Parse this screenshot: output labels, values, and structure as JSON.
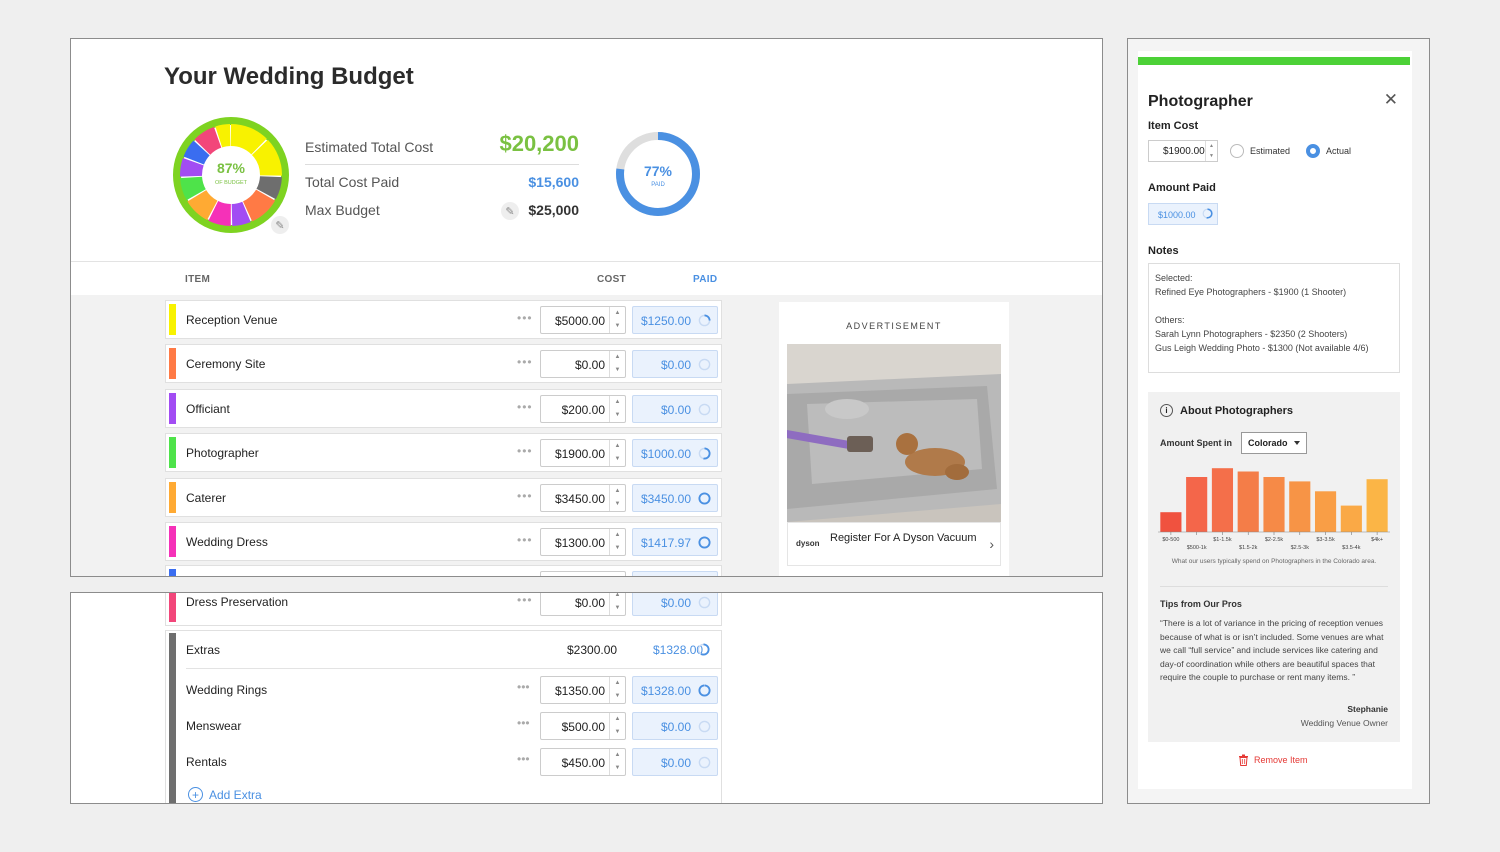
{
  "budget": {
    "title": "Your Wedding Budget",
    "donut_pct": "87%",
    "donut_sub": "OF BUDGET",
    "donut_fraction": 0.87,
    "est_label": "Estimated Total Cost",
    "est_value": "$20,200",
    "paid_label": "Total Cost Paid",
    "paid_value": "$15,600",
    "max_label": "Max Budget",
    "max_value": "$25,000",
    "ring_pct": "77%",
    "ring_sub": "PAID",
    "ring_fraction": 0.77
  },
  "table": {
    "col_item": "ITEM",
    "col_cost": "COST",
    "col_paid": "PAID",
    "rows": [
      {
        "name": "Reception Venue",
        "cost": "$5000.00",
        "paid": "$1250.00",
        "color": "#f8f200",
        "progress": 0.25
      },
      {
        "name": "Ceremony Site",
        "cost": "$0.00",
        "paid": "$0.00",
        "color": "#ff7a45",
        "progress": 0
      },
      {
        "name": "Officiant",
        "cost": "$200.00",
        "paid": "$0.00",
        "color": "#a24cf3",
        "progress": 0
      },
      {
        "name": "Photographer",
        "cost": "$1900.00",
        "paid": "$1000.00",
        "color": "#4ee34a",
        "progress": 0.53
      },
      {
        "name": "Caterer",
        "cost": "$3450.00",
        "paid": "$3450.00",
        "color": "#ffaa33",
        "progress": 1
      },
      {
        "name": "Wedding Dress",
        "cost": "$1300.00",
        "paid": "$1417.97",
        "color": "#f531b8",
        "progress": 1
      }
    ],
    "partial_row_color": "#3a6df0",
    "dress_preservation": {
      "name": "Dress Preservation",
      "cost": "$0.00",
      "paid": "$0.00",
      "color": "#f2467a"
    },
    "extras": {
      "name": "Extras",
      "cost": "$2300.00",
      "paid": "$1328.00",
      "progress": 0.58,
      "items": [
        {
          "name": "Wedding Rings",
          "cost": "$1350.00",
          "paid": "$1328.00",
          "progress": 0.98
        },
        {
          "name": "Menswear",
          "cost": "$500.00",
          "paid": "$0.00",
          "progress": 0
        },
        {
          "name": "Rentals",
          "cost": "$450.00",
          "paid": "$0.00",
          "progress": 0
        }
      ],
      "add_label": "Add Extra"
    }
  },
  "ad": {
    "label": "ADVERTISEMENT",
    "brand": "dyson",
    "text": "Register For A Dyson Vacuum"
  },
  "panel": {
    "title": "Photographer",
    "item_cost_label": "Item Cost",
    "item_cost": "$1900.00",
    "radio_estimated": "Estimated",
    "radio_actual": "Actual",
    "amount_paid_label": "Amount Paid",
    "amount_paid": "$1000.00",
    "notes_label": "Notes",
    "notes_lines": [
      "Selected:",
      "Refined Eye Photographers - $1900 (1 Shooter)",
      "",
      "Others:",
      "Sarah Lynn Photographers - $2350 (2 Shooters)",
      "Gus Leigh Wedding Photo - $1300 (Not available 4/6)"
    ],
    "about_title": "About Photographers",
    "amount_spent_label": "Amount Spent in",
    "region": "Colorado",
    "chart_caption": "What our users typically spend on Photographers in the Colorado area.",
    "tips_title": "Tips from Our Pros",
    "tips_quote": "“There is a lot of variance in the pricing of reception venues because of what is or isn’t included. Some venues are what we call “full service” and include services like catering and day-of coordination while others are beautiful spaces that require the couple to purchase or rent many items. ”",
    "tips_author": "Stephanie",
    "tips_role": "Wedding Venue Owner",
    "remove_label": "Remove Item"
  },
  "chart_data": {
    "type": "bar",
    "categories": [
      "$0-500",
      "$500-1k",
      "$1-1.5k",
      "$1.5-2k",
      "$2-2.5k",
      "$2.5-3k",
      "$3-3.5k",
      "$3.5-4k",
      "$4k+"
    ],
    "values": [
      18,
      50,
      58,
      55,
      50,
      46,
      37,
      24,
      48
    ],
    "colors": [
      "#f0523f",
      "#f4664a",
      "#f46f4a",
      "#f47d48",
      "#f68a47",
      "#f79446",
      "#f99e46",
      "#faa946",
      "#fbb546"
    ],
    "ylim": [
      0,
      60
    ],
    "grid": false
  }
}
